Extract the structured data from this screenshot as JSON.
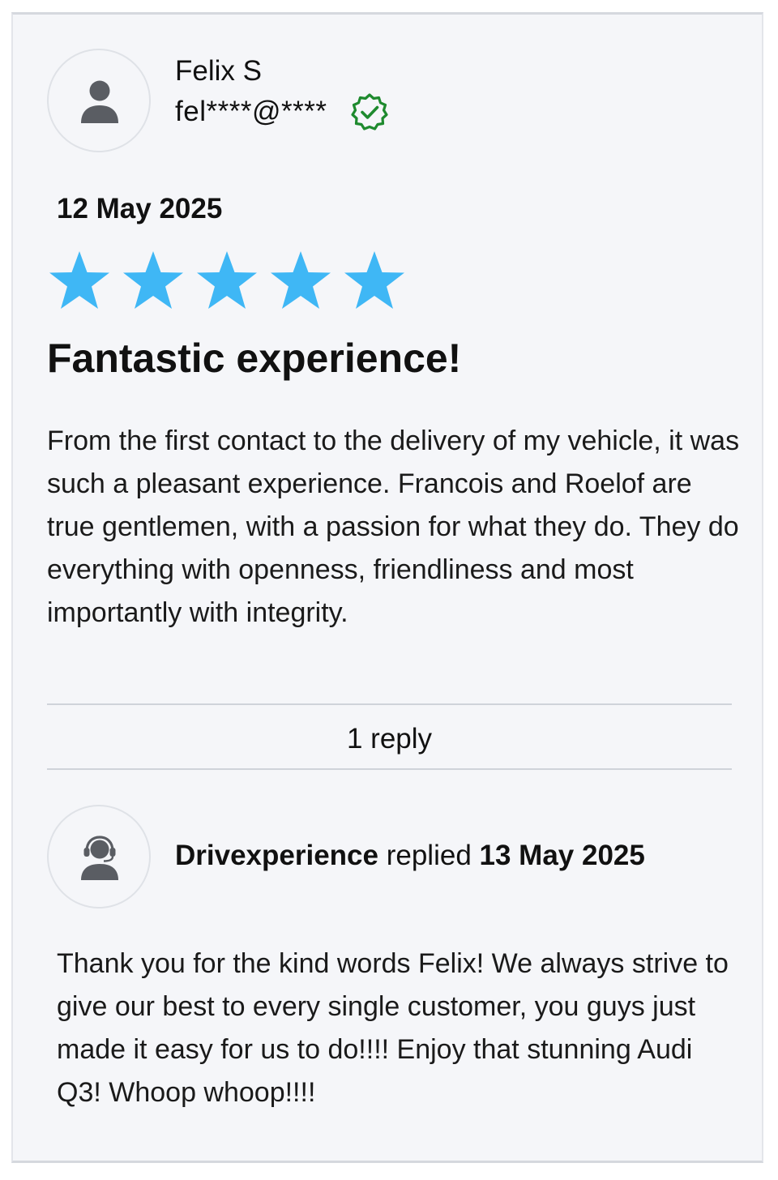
{
  "review": {
    "author_name": "Felix S",
    "author_email": "fel****@****",
    "avatar_icon": "user-icon",
    "verified_icon": "verified-check-icon",
    "verified_color": "#1e8a2e",
    "date": "12 May 2025",
    "rating": 5,
    "rating_max": 5,
    "star_color": "#3fb7f5",
    "title": "Fantastic experience!",
    "body": "From the first contact to the delivery of my vehicle, it was such a pleasant experience. Francois and Roelof are true gentlemen, with a passion for what they do. They do everything with openness, friendliness and most importantly with integrity."
  },
  "replies": {
    "toggle_label": "1 reply"
  },
  "reply": {
    "avatar_icon": "support-agent-icon",
    "company": "Drivexperience",
    "verb": "replied",
    "date": "13 May 2025",
    "body": "Thank you for the kind words Felix! We always strive to give our best to every single customer, you guys just made it easy for us to do!!!! Enjoy that stunning Audi Q3! Whoop whoop!!!!"
  }
}
